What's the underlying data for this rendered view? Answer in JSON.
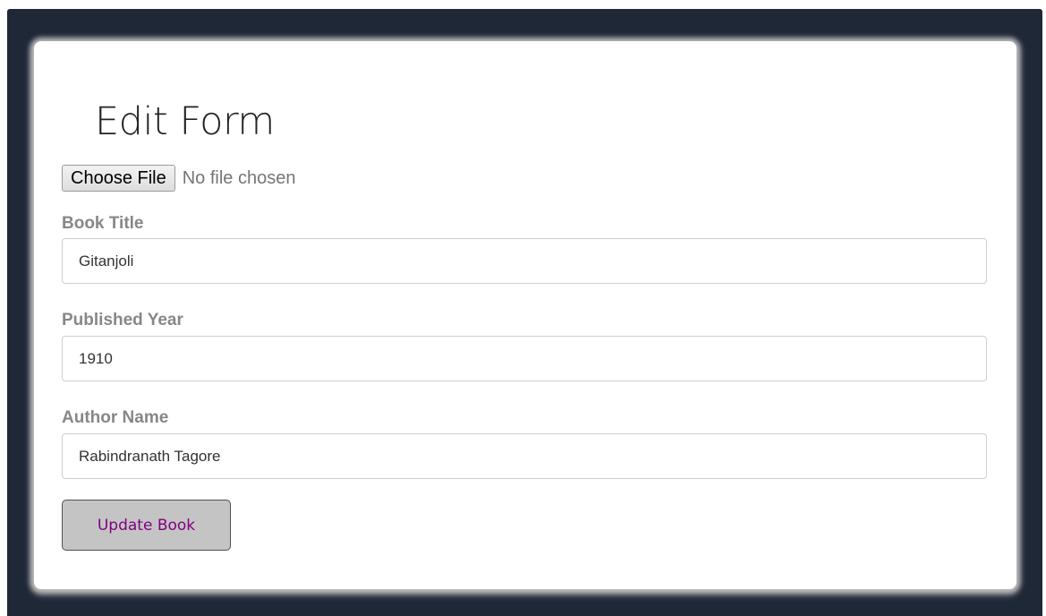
{
  "form": {
    "title": "Edit Form",
    "file_input": {
      "button_label": "Choose File",
      "status_text": "No file chosen"
    },
    "fields": [
      {
        "label": "Book Title",
        "value": "Gitanjoli"
      },
      {
        "label": "Published Year",
        "value": "1910"
      },
      {
        "label": "Author Name",
        "value": "Rabindranath Tagore"
      }
    ],
    "submit_label": "Update Book"
  },
  "colors": {
    "frame_background": "#1f2837",
    "card_background": "#ffffff",
    "label_text": "#878787",
    "button_background": "#c4c4c4",
    "button_text": "#800080"
  }
}
